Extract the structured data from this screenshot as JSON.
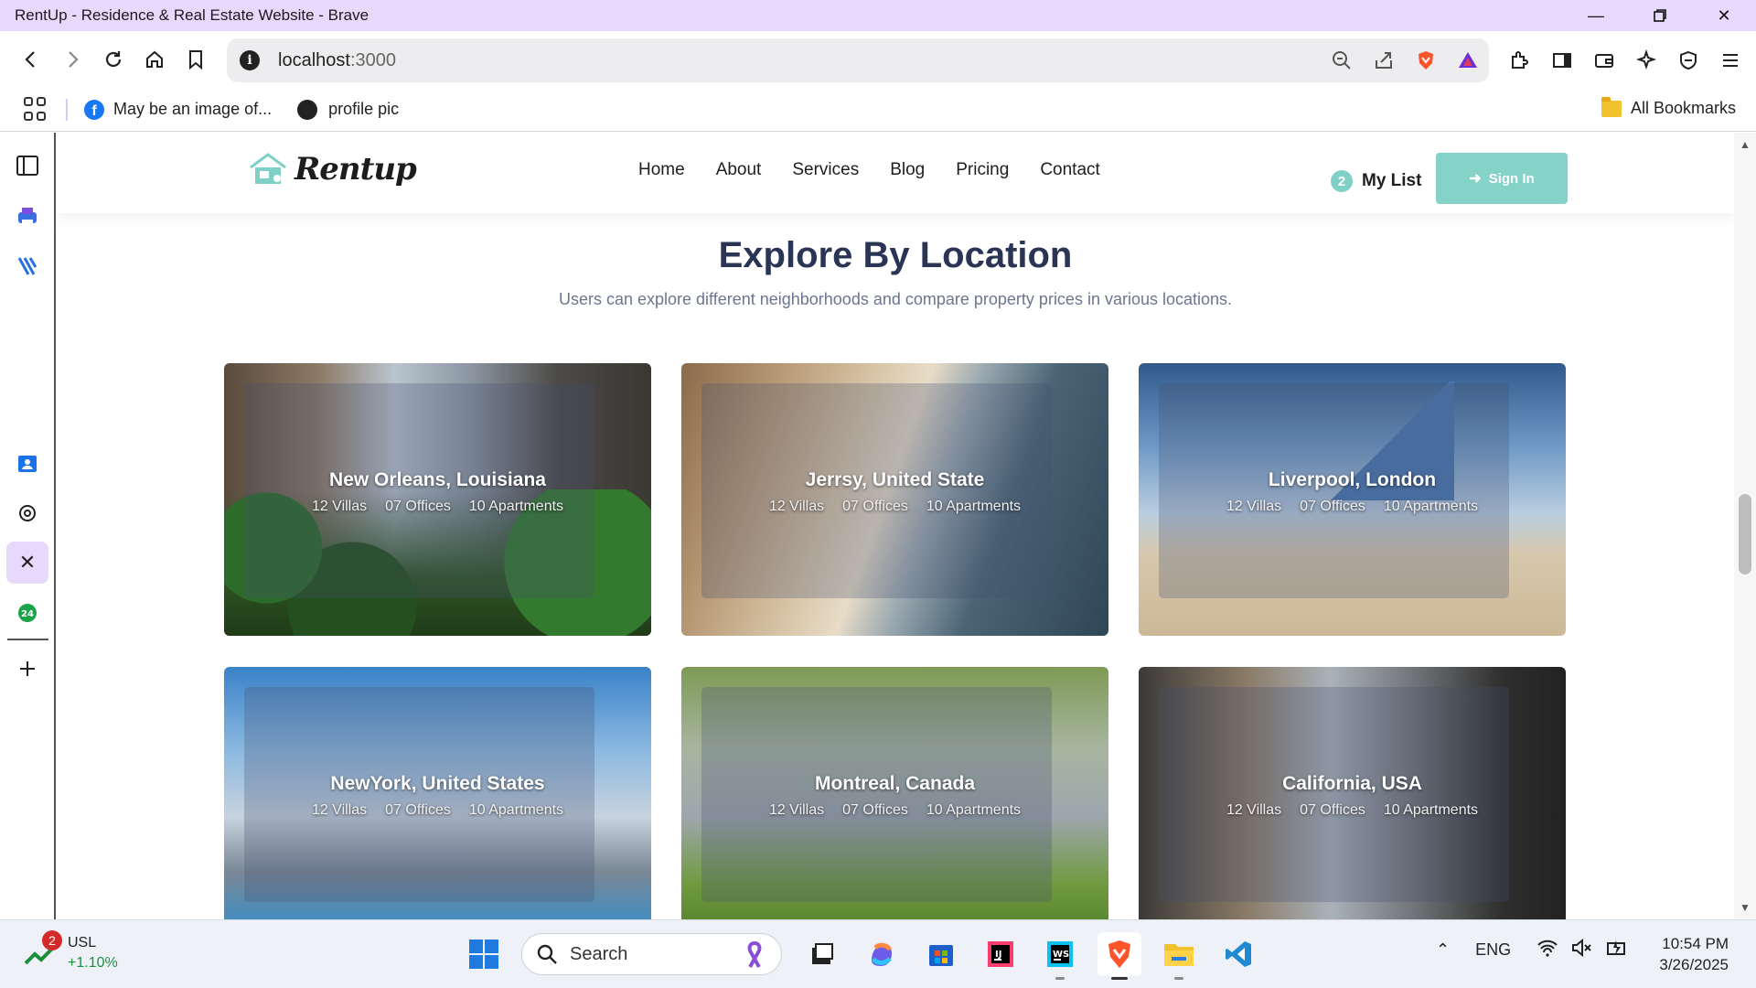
{
  "window": {
    "title": "RentUp - Residence & Real Estate Website - Brave",
    "controls": [
      "minimize-icon",
      "restore-icon",
      "close-icon"
    ]
  },
  "toolbar": {
    "url_host": "localhost",
    "url_port": ":3000",
    "info_glyph": "i"
  },
  "bookmarks": {
    "items": [
      {
        "label": "May be an image of...",
        "icon": "facebook-icon"
      },
      {
        "label": "profile pic",
        "icon": "globe-icon"
      }
    ],
    "all_bookmarks": "All Bookmarks"
  },
  "site": {
    "logo_text": "Rentup",
    "nav": [
      "Home",
      "About",
      "Services",
      "Blog",
      "Pricing",
      "Contact"
    ],
    "my_list_count": "2",
    "my_list_label": "My List",
    "sign_in": "Sign In",
    "accent_color": "#85d2c8",
    "heading_color": "#2a3555"
  },
  "section": {
    "title": "Explore By Location",
    "subtitle": "Users can explore different neighborhoods and compare property prices in various locations."
  },
  "locations": [
    {
      "name": "New Orleans, Louisiana",
      "villas": "12 Villas",
      "offices": "07 Offices",
      "apartments": "10 Apartments"
    },
    {
      "name": "Jerrsy, United State",
      "villas": "12 Villas",
      "offices": "07 Offices",
      "apartments": "10 Apartments"
    },
    {
      "name": "Liverpool, London",
      "villas": "12 Villas",
      "offices": "07 Offices",
      "apartments": "10 Apartments"
    },
    {
      "name": "NewYork, United States",
      "villas": "12 Villas",
      "offices": "07 Offices",
      "apartments": "10 Apartments"
    },
    {
      "name": "Montreal, Canada",
      "villas": "12 Villas",
      "offices": "07 Offices",
      "apartments": "10 Apartments"
    },
    {
      "name": "California, USA",
      "villas": "12 Villas",
      "offices": "07 Offices",
      "apartments": "10 Apartments"
    }
  ],
  "taskbar": {
    "widget_badge": "2",
    "widget_symbol": "USL",
    "widget_change": "+1.10%",
    "search_label": "Search",
    "lang": "ENG",
    "time": "10:54 PM",
    "date": "3/26/2025"
  }
}
